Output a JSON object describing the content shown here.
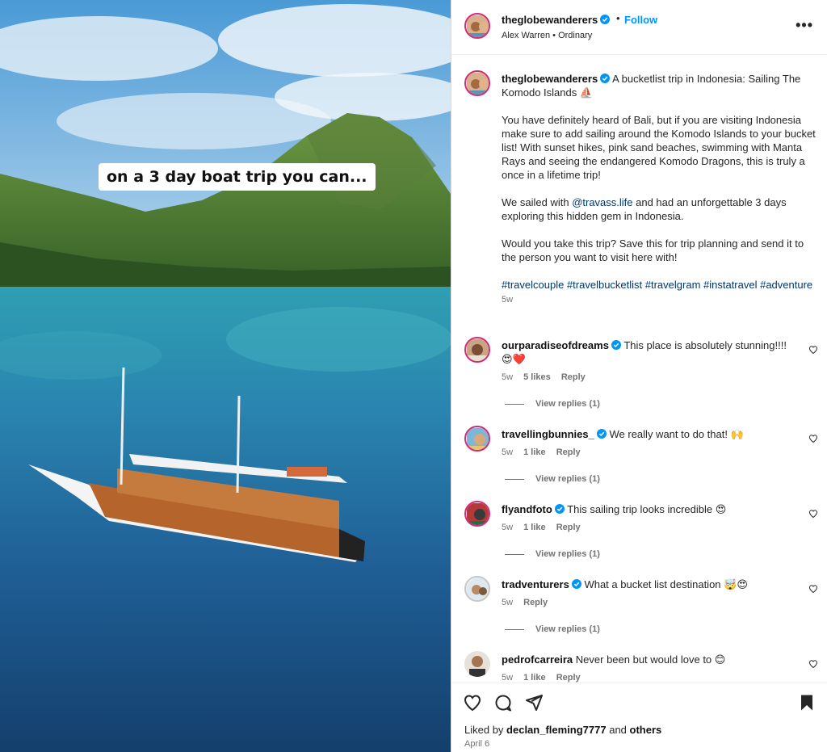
{
  "media": {
    "overlay_text": "on a 3 day boat trip you can..."
  },
  "header": {
    "username": "theglobewanderers",
    "follow_label": "Follow",
    "separator": "•",
    "audio": "Alex Warren • Ordinary",
    "more_label": "•••"
  },
  "caption": {
    "username": "theglobewanderers",
    "first_line": "A bucketlist trip in Indonesia: Sailing The Komodo Islands",
    "first_emoji": "⛵",
    "p1": "You have definitely heard of Bali, but if you are visiting Indonesia make sure to add sailing around the Komodo Islands to your bucket list! With sunset hikes, pink sand beaches, swimming with Manta Rays and seeing the endangered Komodo Dragons, this is truly a once in a lifetime trip!",
    "p2_before": "We sailed with ",
    "p2_mention": "@travass.life",
    "p2_after": " and had an unforgettable 3 days exploring this hidden gem in Indonesia.",
    "p3": "Would you take this trip? Save this for trip planning and send it to the person you want to visit here with!",
    "hashtags": "#travelcouple #travelbucketlist #travelgram #instatravel #adventure",
    "time": "5w"
  },
  "comments": [
    {
      "username": "ourparadiseofdreams",
      "verified": true,
      "text": "This place is absolutely stunning!!!! 😍❤️",
      "time": "5w",
      "likes": "5 likes",
      "reply": "Reply",
      "view_replies": "View replies (1)"
    },
    {
      "username": "travellingbunnies_",
      "verified": true,
      "text": "We really want to do that! 🙌",
      "time": "5w",
      "likes": "1 like",
      "reply": "Reply",
      "view_replies": "View replies (1)"
    },
    {
      "username": "flyandfoto",
      "verified": true,
      "text": "This sailing trip looks incredible 😍",
      "time": "5w",
      "likes": "1 like",
      "reply": "Reply",
      "view_replies": "View replies (1)"
    },
    {
      "username": "tradventurers",
      "verified": true,
      "text": "What a bucket list destination 🤯😍",
      "time": "5w",
      "likes": "",
      "reply": "Reply",
      "view_replies": "View replies (1)"
    },
    {
      "username": "pedrofcarreira",
      "verified": false,
      "text": "Never been but would love to 😊",
      "time": "5w",
      "likes": "1 like",
      "reply": "Reply",
      "view_replies": ""
    }
  ],
  "footer": {
    "liked_by_prefix": "Liked by ",
    "liked_by_user": "declan_fleming7777",
    "liked_by_and": " and ",
    "liked_by_others": "others",
    "date": "April 6"
  },
  "colors": {
    "accent": "#0095f6",
    "verified": "#0095f6",
    "link": "#00376b"
  },
  "icons": [
    "heart-icon",
    "comment-icon",
    "share-icon",
    "bookmark-icon",
    "verified-icon",
    "more-icon"
  ]
}
